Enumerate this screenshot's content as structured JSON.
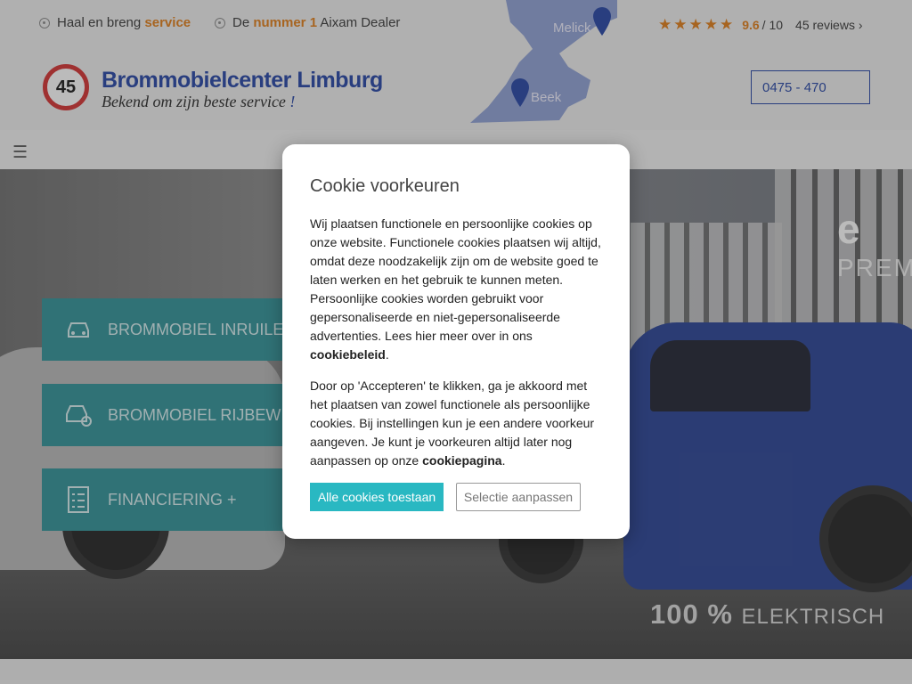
{
  "topbar": {
    "usp1_prefix": "Haal en breng ",
    "usp1_highlight": "service",
    "usp2_prefix": "De ",
    "usp2_highlight": "nummer 1",
    "usp2_suffix": " Aixam Dealer",
    "rating_stars": "★★★★★",
    "rating_score": "9.6",
    "rating_scale": "/ 10",
    "reviews_label": "45 reviews ›"
  },
  "header": {
    "logo_number": "45",
    "logo_title": "Brommobielcenter Limburg",
    "logo_tagline": "Bekend om zijn beste service",
    "logo_tagline_end": " !",
    "map_labels": [
      "Melick",
      "Beek"
    ],
    "phone": "0475 - 470"
  },
  "nav": {
    "menu_icon": "☰"
  },
  "hero": {
    "tiles": [
      {
        "label": "BROMMOBIEL INRUILEN",
        "icon": "car-icon"
      },
      {
        "label": "BROMMOBIEL RIJBEWIJ",
        "icon": "driver-icon"
      },
      {
        "label": "FINANCIERING +",
        "icon": "checklist-icon"
      }
    ],
    "brand_letter": "e",
    "brand_sub": "PREM",
    "electric_pct": "100 %",
    "electric_label": "ELEKTRISCH"
  },
  "cookie": {
    "title": "Cookie voorkeuren",
    "para1": "Wij plaatsen functionele en persoonlijke cookies op onze website. Functionele cookies plaatsen wij altijd, omdat deze noodzakelijk zijn om de website goed te laten werken en het gebruik te kunnen meten. Persoonlijke cookies worden gebruikt voor gepersonaliseerde en niet-gepersonaliseerde advertenties. Lees hier meer over in ons ",
    "para1_link": "cookiebeleid",
    "para1_end": ".",
    "para2": "Door op 'Accepteren' te klikken, ga je akkoord met het plaatsen van zowel functionele als persoonlijke cookies. Bij instellingen kun je een andere voorkeur aangeven. Je kunt je voorkeuren altijd later nog aanpassen op onze ",
    "para2_link": "cookiepagina",
    "para2_end": ".",
    "accept_label": "Alle cookies toestaan",
    "adjust_label": "Selectie aanpassen"
  },
  "colors": {
    "accent": "#e07a12",
    "brand_blue": "#1f3fa3",
    "teal": "#29b8c2"
  }
}
